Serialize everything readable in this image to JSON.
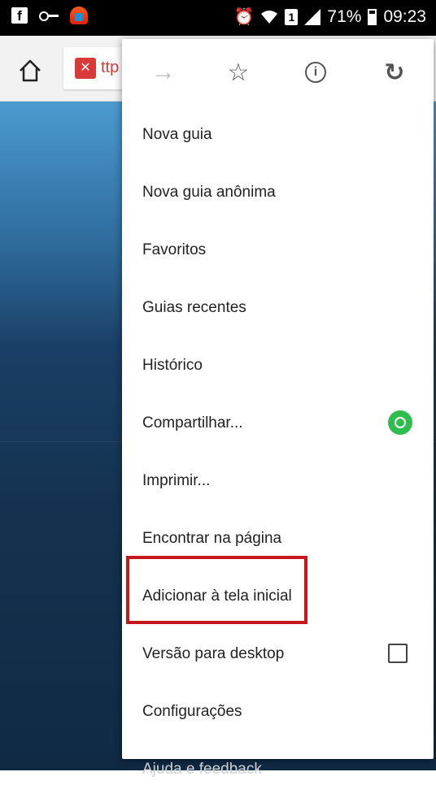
{
  "status_bar": {
    "sim_slot": "1",
    "battery_percent": "71%",
    "battery_level": 0.71,
    "time": "09:23",
    "icons": [
      "facebook-icon",
      "key-icon",
      "vpn-icon",
      "alarm-icon",
      "wifi-icon",
      "sim-icon",
      "signal-icon",
      "battery-icon"
    ]
  },
  "toolbar": {
    "url_fragment": "ttp",
    "icons": [
      "home-icon",
      "lock-x-icon"
    ]
  },
  "menu": {
    "icon_row": [
      "forward-icon",
      "star-icon",
      "info-icon",
      "reload-icon"
    ],
    "items": [
      {
        "label": "Nova guia"
      },
      {
        "label": "Nova guia anônima"
      },
      {
        "label": "Favoritos"
      },
      {
        "label": "Guias recentes"
      },
      {
        "label": "Histórico"
      },
      {
        "label": "Compartilhar...",
        "icon": "whatsapp-icon"
      },
      {
        "label": "Imprimir..."
      },
      {
        "label": "Encontrar na página"
      },
      {
        "label": "Adicionar à tela inicial"
      },
      {
        "label": "Versão para desktop",
        "checkbox": false
      },
      {
        "label": "Configurações"
      },
      {
        "label": "Ajuda e feedback"
      }
    ]
  },
  "colors": {
    "highlight": "#c8161d",
    "whatsapp": "#2fbd4f",
    "page_background": "#1a3f66"
  }
}
